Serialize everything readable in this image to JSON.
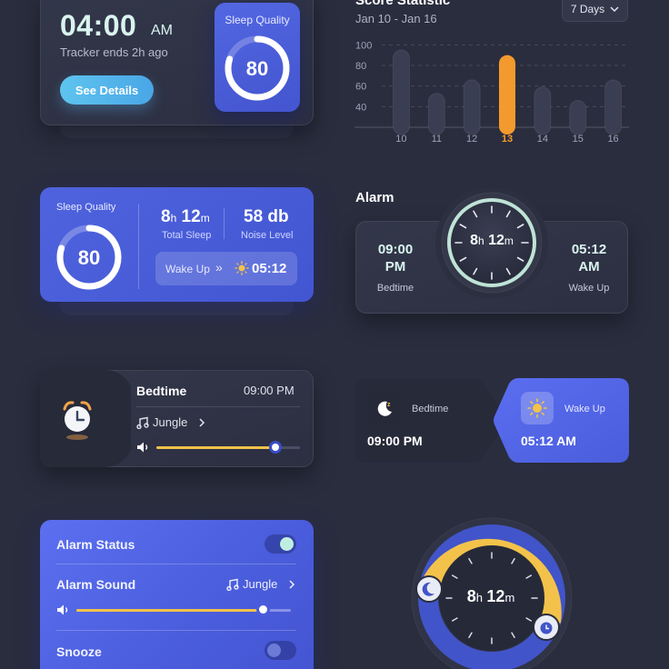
{
  "tracker": {
    "time": "04:00",
    "ampm": "AM",
    "subtitle": "Tracker ends 2h ago",
    "button_label": "See Details",
    "quality_title": "Sleep Quality",
    "quality_value": "80",
    "quality_percent": 80
  },
  "score_statistic": {
    "title": "Score Statistic",
    "range": "Jan 10 - Jan 16",
    "period_select": "7 Days"
  },
  "chart_data": {
    "type": "bar",
    "title": "Score Statistic",
    "categories": [
      "10",
      "11",
      "12",
      "13",
      "14",
      "15",
      "16"
    ],
    "values": [
      95,
      53,
      66,
      90,
      59,
      46,
      66
    ],
    "highlight_index": 3,
    "y_ticks": [
      100,
      80,
      60,
      40
    ],
    "ylim": [
      20,
      110
    ],
    "grid": true,
    "colors": {
      "bar": "#3a3e52",
      "highlight": "#f39a2e",
      "highlight_label": "#f39a2e",
      "label": "#9ea3b5"
    }
  },
  "sleep_summary": {
    "quality_title": "Sleep Quality",
    "quality_value": "80",
    "quality_percent": 80,
    "total_sleep_h": "8",
    "total_sleep_h_unit": "h",
    "total_sleep_m": "12",
    "total_sleep_m_unit": "m",
    "total_sleep_label": "Total Sleep",
    "noise_value": "58 db",
    "noise_label": "Noise Level",
    "wakeup_label": "Wake Up",
    "wakeup_arrows": "»",
    "wakeup_time": "05:12"
  },
  "alarm": {
    "title": "Alarm",
    "bedtime_time": "09:00 PM",
    "bedtime_time_line1": "09:00",
    "bedtime_time_line2": "PM",
    "bedtime_label": "Bedtime",
    "wake_time_line1": "05:12",
    "wake_time_line2": "AM",
    "wake_label": "Wake Up",
    "duration_h": "8",
    "duration_m": "12",
    "unit_h": "h",
    "unit_m": "m"
  },
  "bedtime_player": {
    "title": "Bedtime",
    "time": "09:00 PM",
    "sound": "Jungle",
    "volume_percent": 83
  },
  "chips": {
    "bedtime_label": "Bedtime",
    "bedtime_time": "09:00 PM",
    "wake_label": "Wake Up",
    "wake_time": "05:12 AM"
  },
  "alarm_settings": {
    "status_label": "Alarm Status",
    "status_on": true,
    "sound_label": "Alarm Sound",
    "sound_value": "Jungle",
    "volume_percent": 87,
    "snooze_label": "Snooze",
    "snooze_on": false
  },
  "sleep_dial": {
    "duration_h": "8",
    "duration_m": "12",
    "unit_h": "h",
    "unit_m": "m"
  },
  "icons": {
    "chevron": "chevron-down-icon",
    "music": "music-note-icon",
    "volume": "volume-icon",
    "sun": "sun-icon",
    "moon": "moon-icon",
    "alarm_clock": "alarm-clock-icon"
  },
  "colors": {
    "background": "#2a2d3e",
    "card_blue": "#4a5ddc",
    "accent_orange": "#f39a2e",
    "accent_yellow": "#f3c24a",
    "accent_mint": "#d9f4ee",
    "button_cyan": "#5ec4ef"
  }
}
